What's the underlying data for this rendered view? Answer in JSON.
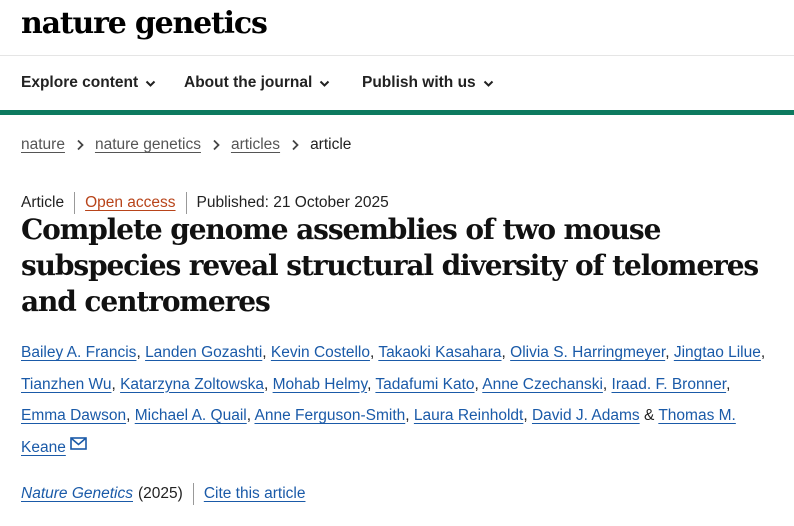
{
  "site": {
    "logo": "nature genetics"
  },
  "nav": {
    "items": [
      {
        "label": "Explore content"
      },
      {
        "label": "About the journal"
      },
      {
        "label": "Publish with us"
      }
    ]
  },
  "breadcrumb": [
    "nature",
    "nature genetics",
    "articles",
    "article"
  ],
  "meta": {
    "type": "Article",
    "access": "Open access",
    "published": "Published: 21 October 2025"
  },
  "title": "Complete genome assemblies of two mouse subspecies reveal structural diversity of telomeres and centromeres",
  "authors": [
    "Bailey A. Francis",
    "Landen Gozashti",
    "Kevin Costello",
    "Takaoki Kasahara",
    "Olivia S. Harringmeyer",
    "Jingtao Lilue",
    "Tianzhen Wu",
    "Katarzyna Zoltowska",
    "Mohab Helmy",
    "Tadafumi Kato",
    "Anne Czechanski",
    "Iraad. F. Bronner",
    "Emma Dawson",
    "Michael A. Quail",
    "Anne Ferguson-Smith",
    "Laura Reinholdt",
    "David J. Adams",
    "Thomas M. Keane"
  ],
  "citation": {
    "journal": "Nature Genetics",
    "year": "(2025)",
    "cite_label": "Cite this article"
  },
  "colors": {
    "accent_green": "#0d7a5f",
    "link_blue": "#1a5aa8",
    "open_access_orange": "#b8441a"
  }
}
